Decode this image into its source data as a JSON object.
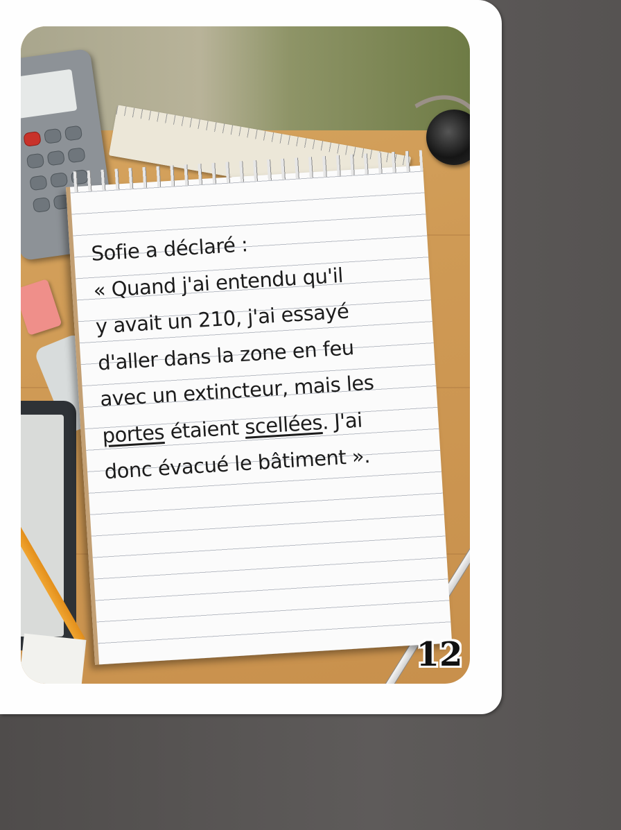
{
  "card": {
    "statement": {
      "line1": "Sofie a déclaré :",
      "line2": "« Quand j'ai entendu qu'il",
      "line3": "y avait un 210, j'ai essayé",
      "line4": "d'aller dans la zone en feu",
      "line5": "avec un extincteur, mais les",
      "line6_word1": "portes",
      "line6_mid": " étaient ",
      "line6_word2": "scellées",
      "line6_end": ". J'ai",
      "line7": "donc évacué le bâtiment »."
    },
    "number": "12"
  },
  "icons": [
    "calculator-icon",
    "ruler-icon",
    "eraser-icon",
    "phone-icon",
    "tablet-icon",
    "pencil-icon",
    "webcam-icon",
    "pen-icon",
    "notepad-icon"
  ],
  "colors": {
    "background": "#5a5756",
    "card": "#fefefe",
    "desk": "#d4a05c",
    "paper": "#fbfbfb",
    "ink": "#1c1c1c"
  }
}
